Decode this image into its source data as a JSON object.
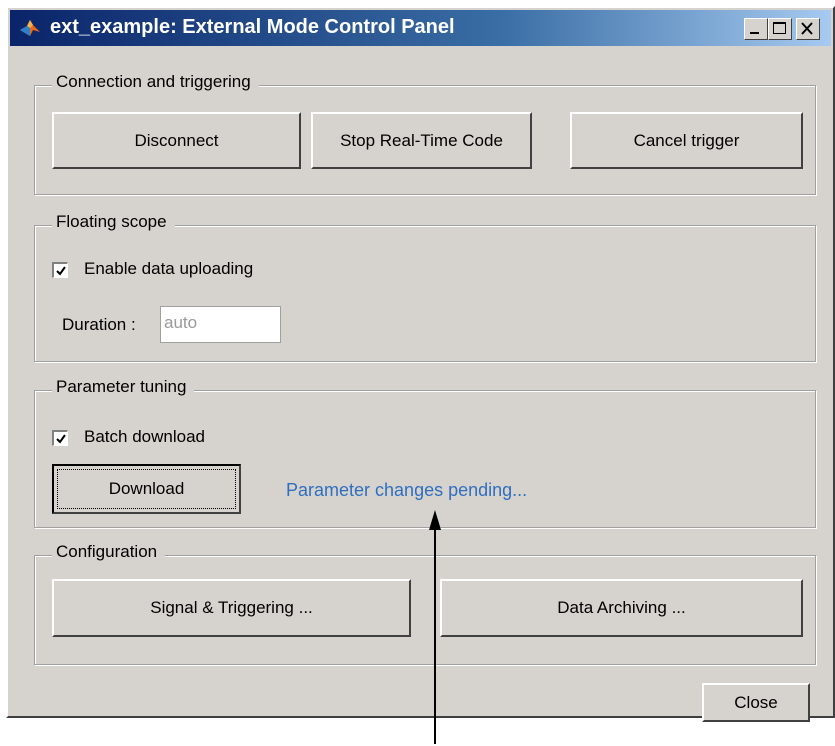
{
  "window": {
    "title": "ext_example: External Mode Control Panel"
  },
  "connection": {
    "legend": "Connection and triggering",
    "disconnect_label": "Disconnect",
    "stop_label": "Stop Real-Time Code",
    "cancel_trigger_label": "Cancel trigger"
  },
  "floating_scope": {
    "legend": "Floating scope",
    "enable_label": "Enable data uploading",
    "enable_checked": true,
    "duration_label": "Duration :",
    "duration_value": "auto"
  },
  "parameter_tuning": {
    "legend": "Parameter tuning",
    "batch_label": "Batch download",
    "batch_checked": true,
    "download_label": "Download",
    "status_text": "Parameter changes pending..."
  },
  "configuration": {
    "legend": "Configuration",
    "signal_label": "Signal & Triggering ...",
    "archiving_label": "Data Archiving ..."
  },
  "footer": {
    "close_label": "Close"
  },
  "colors": {
    "status_text": "#2f6fbf",
    "titlebar_start": "#0a246a"
  }
}
